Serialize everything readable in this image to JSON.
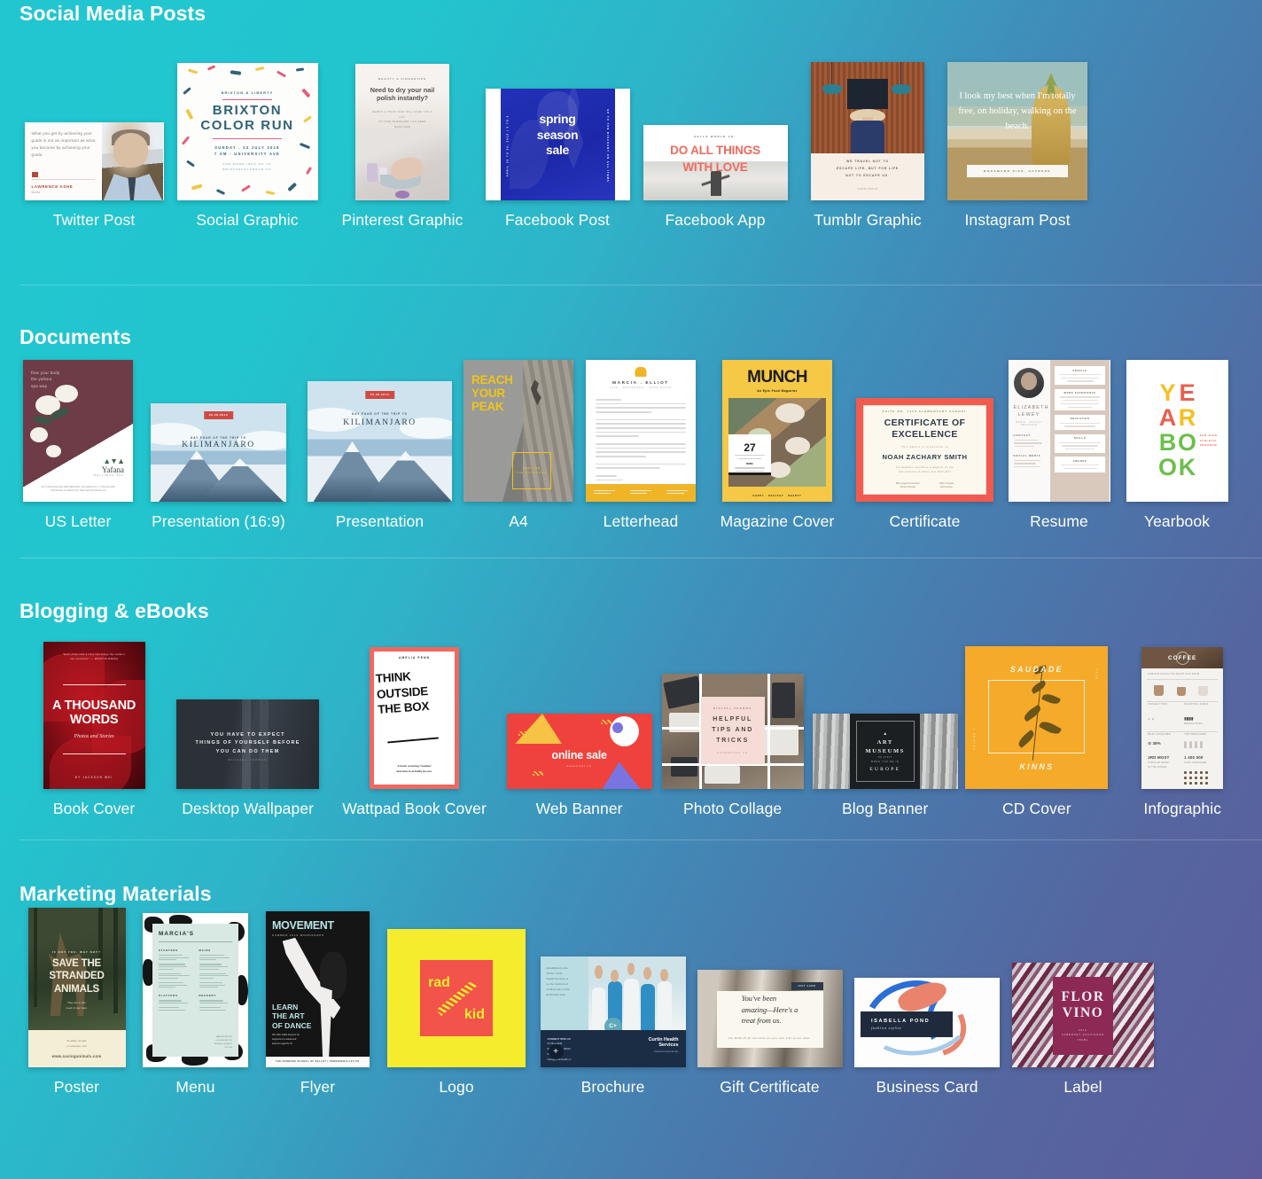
{
  "sections": [
    {
      "id": "social-media-posts",
      "heading": "Social Media Posts",
      "items": [
        {
          "id": "twitter-post",
          "label": "Twitter Post"
        },
        {
          "id": "social-graphic",
          "label": "Social Graphic"
        },
        {
          "id": "pinterest-graphic",
          "label": "Pinterest Graphic"
        },
        {
          "id": "facebook-post",
          "label": "Facebook Post"
        },
        {
          "id": "facebook-app",
          "label": "Facebook App"
        },
        {
          "id": "tumblr-graphic",
          "label": "Tumblr Graphic"
        },
        {
          "id": "instagram-post",
          "label": "Instagram Post"
        }
      ]
    },
    {
      "id": "documents",
      "heading": "Documents",
      "items": [
        {
          "id": "us-letter",
          "label": "US Letter"
        },
        {
          "id": "presentation-16-9",
          "label": "Presentation (16:9)"
        },
        {
          "id": "presentation",
          "label": "Presentation"
        },
        {
          "id": "a4",
          "label": "A4"
        },
        {
          "id": "letterhead",
          "label": "Letterhead"
        },
        {
          "id": "magazine-cover",
          "label": "Magazine Cover"
        },
        {
          "id": "certificate",
          "label": "Certificate"
        },
        {
          "id": "resume",
          "label": "Resume"
        },
        {
          "id": "yearbook",
          "label": "Yearbook"
        }
      ]
    },
    {
      "id": "blogging-ebooks",
      "heading": "Blogging & eBooks",
      "items": [
        {
          "id": "book-cover",
          "label": "Book Cover"
        },
        {
          "id": "desktop-wallpaper",
          "label": "Desktop Wallpaper"
        },
        {
          "id": "wattpad-book-cover",
          "label": "Wattpad Book Cover"
        },
        {
          "id": "web-banner",
          "label": "Web Banner"
        },
        {
          "id": "photo-collage",
          "label": "Photo Collage"
        },
        {
          "id": "blog-banner",
          "label": "Blog Banner"
        },
        {
          "id": "cd-cover",
          "label": "CD Cover"
        },
        {
          "id": "infographic",
          "label": "Infographic"
        }
      ]
    },
    {
      "id": "marketing-materials",
      "heading": "Marketing Materials",
      "items": [
        {
          "id": "poster",
          "label": "Poster"
        },
        {
          "id": "menu",
          "label": "Menu"
        },
        {
          "id": "flyer",
          "label": "Flyer"
        },
        {
          "id": "logo",
          "label": "Logo"
        },
        {
          "id": "brochure",
          "label": "Brochure"
        },
        {
          "id": "gift-certificate",
          "label": "Gift Certificate"
        },
        {
          "id": "business-card",
          "label": "Business Card"
        },
        {
          "id": "label",
          "label": "Label"
        }
      ]
    }
  ],
  "thumbnails": {
    "twitter_post": {
      "quote": "What you get by achieving your goals is not as important as what you become by achieving your goals.",
      "name": "LAWRENCE ASHE",
      "role": "Mentor"
    },
    "social_graphic": {
      "eyebrow": "BRIXTON & LIBERTY",
      "title_line1": "BRIXTON",
      "title_line2": "COLOR RUN",
      "date_line1": "SUNDAY  .  23 JULY 2018",
      "date_line2": "7 AM  -  UNIVERSITY AVE",
      "small_line1": "FOR MORE INFO GO TO",
      "small_line2": "BRIXTONCOLORRUN.CO"
    },
    "pinterest_graphic": {
      "eyebrow": "BEAUTY & FINGERTIPS",
      "title": "Need to dry your nail polish instantly?",
      "sub_line1": "HERE'S A TRICK THAT WILL SAVE YOU A LOT",
      "sub_line2": "OF TIME WHENEVER YOU NEED MANICURE"
    },
    "facebook_post": {
      "headline_line1": "spring",
      "headline_line2": "season",
      "headline_line3": "sale",
      "side_left": "APRIL 28 TO 30, 2018 | 9 TO 5",
      "side_right": "UP TO 70% DISCOUNT ON ALL ITEMS"
    },
    "facebook_app": {
      "eyebrow": "HELLO WORLD CO.",
      "headline_line1": "DO ALL THINGS",
      "headline_line2": "WITH LOVE"
    },
    "tumblr_graphic": {
      "quote_line1": "WE TRAVEL NOT TO",
      "quote_line2": "ESCAPE LIFE, BUT FOR LIFE",
      "quote_line3": "NOT TO ESCAPE US.",
      "attribution": "ANONYMOUS"
    },
    "instagram_post": {
      "quote": "I look my best when I'm totally free, on holiday, walking on the beach.",
      "plate": "ROSAMUND PIKE, ACTRESS"
    },
    "us_letter": {
      "headline_line1": "flow your body",
      "headline_line2": "the yafana",
      "headline_line3": "spa way",
      "brand": "Yafana",
      "brand_sub": "WELLNESS SPA",
      "footer_line1": "1671 HIGHLAND AVE NEW BEDFORD, MA 02840-1972  |  T: 555-294-4658",
      "footer_line2": "YAFANASPA.CO  REACHUS: HELLO@YAFANASPA.CO"
    },
    "presentation_169": {
      "badge": "05.28.2014",
      "eyebrow": "DAY FOUR OF THE TRIP TO",
      "title": "KILIMANJARO"
    },
    "presentation": {
      "badge": "05.28.2014",
      "eyebrow": "DAY FOUR OF THE TRIP TO",
      "title": "KILIMANJARO"
    },
    "a4": {
      "headline_line1": "REACH",
      "headline_line2": "YOUR",
      "headline_line3": "PEAK",
      "box_line1": "EXPLORE",
      "box_line2": "THE OUTDOORS"
    },
    "letterhead": {
      "name": "MARCIA . ELLIOT",
      "sub": "CAFE . RESTAURANT . BAKE HOUSE",
      "sign_off": "Sincerely,",
      "signature": "Marcia Elliot"
    },
    "magazine_cover": {
      "title": "MUNCH",
      "subtitle": "An Epic Food Magazine",
      "number": "27",
      "card_line1": "BEST VEGGIE DISHES FROM AROUND THE WORLD",
      "card_label": "MORE",
      "footer": "HAPPY . HEALTHY . HEARTY"
    },
    "certificate": {
      "eyebrow": "SUITE NO. 1400 ELEMENTARY SCHOOL",
      "title_line1": "CERTIFICATE OF",
      "title_line2": "EXCELLENCE",
      "presented": "This award is presented to",
      "name": "NOAH ZACHARY SMITH",
      "desc_line1": "For academic excellence in English, for the",
      "desc_line2": "first semester of school year 2016-2017",
      "sig_left_line1": "Mary Angelica Fernandez",
      "sig_left_line2": "School Principal",
      "sig_right_line1": "Wilbur Douglas",
      "sig_right_line2": "Class Adviser"
    },
    "resume": {
      "name_line1": "ELIZABETH",
      "name_line2": "LEWEY",
      "role": "MEDIA . DIGITAL DESIGNER",
      "section1": "CONTACT",
      "section2": "SOCIAL MEDIA",
      "rsection1": "PROFILE",
      "rsection2": "WORK EXPERIENCE",
      "rsection3": "EDUCATION",
      "rsection4": "SKILLS",
      "rsection5": "AWARDS"
    },
    "yearbook": {
      "letters": [
        "Y",
        "E",
        "A",
        "R",
        "B",
        "O",
        "O",
        "K"
      ],
      "colors": [
        "#f3c01f",
        "#e8604f",
        "#e8604f",
        "#f3c01f",
        "#6bbf4b",
        "#6bbf4b",
        "#6bbf4b",
        "#6bbf4b"
      ],
      "badge_line1": "SAN JUAN",
      "badge_line2": "ATHLETIC",
      "badge_line3": "PROGRAM"
    },
    "book_cover": {
      "praise_line1": "\"Each photo tells a story that brings the reader's",
      "praise_line2": "own memories.\" — WINSTON MARSH",
      "title_line1": "A THOUSAND",
      "title_line2": "WORDS",
      "subtitle": "Photos and Stories",
      "author": "BY JACKSON WEI"
    },
    "desktop_wallpaper": {
      "quote_line1": "YOU HAVE TO EXPECT",
      "quote_line2": "THINGS OF YOURSELF BEFORE",
      "quote_line3": "YOU CAN DO THEM",
      "attribution": "MICHAEL JORDAN"
    },
    "wattpad_book_cover": {
      "author": "AMELIA PENN",
      "title_line1": "THINK",
      "title_line2": "OUTSIDE",
      "title_line3": "THE BOX",
      "sub_line1": "A book on being 'creative'",
      "sub_line2": "and how to actually be one."
    },
    "web_banner": {
      "headline": "online sale",
      "sub": "Essential.co"
    },
    "photo_collage": {
      "eyebrow": "DIGITAL TRENDS",
      "title_line1": "HELPFUL",
      "title_line2": "TIPS AND",
      "title_line3": "TRICKS",
      "sub": "HOMEBASED.CO"
    },
    "blog_banner": {
      "title_line1": "ART",
      "title_line2": "MUSEUMS",
      "sub_line1": "TO VISIT",
      "sub_line2": "WHEN YOU'RE IN",
      "region": "EUROPE"
    },
    "cd_cover": {
      "top": "SAUDADE",
      "bottom": "KINNS",
      "side_left": "VOLUME I",
      "side_right": "2018"
    },
    "infographic": {
      "title": "COFFEE",
      "sub": "CURIOUS FACTS YOU MIGHT NOT KNOW",
      "stat1": "3RD MOST",
      "stat2": "1 400 000",
      "label1": "POPULAR DRINK",
      "label2": "IN THE WORLD",
      "label3": "CUPS CONSUMED"
    },
    "poster": {
      "eyebrow": "IF NOT YOU, WHY NOT?",
      "title_line1": "SAVE THE",
      "title_line2": "STRANDED",
      "title_line3": "ANIMALS",
      "sub_line1": "They are in dire",
      "sub_line2": "need of your help.",
      "foot_line1": "To adopt, donate",
      "foot_line2": "or volunteer, visit",
      "foot_url": "www.savinganimals.com"
    },
    "menu": {
      "title": "MARCIA'S",
      "col1_h1": "STARTERS",
      "col1_h2": "PLATTERS",
      "col2_h1": "MAINS",
      "col2_h2": "DESSERT",
      "footer_line1": "MARCIA'S BISTRO",
      "footer_line2": "1400 WHITEWOOD",
      "footer_line3": "AVENUE, MILLBURY",
      "footer_line4": "555 0198"
    },
    "flyer": {
      "title": "MOVEMENT",
      "sub": "SUMMER 2019 WORKSHOPS",
      "headline_line1": "LEARN",
      "headline_line2": "THE ART",
      "headline_line3": "OF DANCE",
      "body_line1": "We offer ballet lessons for",
      "body_line2": "beginners to advanced",
      "body_line3": "learners aged 5-19.",
      "footer": "THE PENROSE SCHOOL OF BALLET  |  PENROSEBALLET.CO"
    },
    "logo": {
      "word1": "rad",
      "word2": "kid"
    },
    "brochure": {
      "intro_line1": "Established in the",
      "intro_line2": "1970s, Curtin",
      "intro_line3": "Health Services is",
      "intro_line4": "on the forefront of",
      "intro_line5": "medical care in the",
      "intro_line6": "El Dorado area.",
      "badge": "C+",
      "contact_label": "CONNECT WITH US",
      "contact_line1": "PO Box 4648",
      "contact_line2": "El Dorado, CA 95623",
      "contact_line3": "555 0132",
      "contact_line4": "hello@curtinhealth.co",
      "brand_line1": "Curtin Health",
      "brand_line2": "Services",
      "brand_sub": "Trusted and personal care"
    },
    "gift_certificate": {
      "tab": "GIFT CARD",
      "quote_line1": "You've been",
      "quote_line2": "amazing—Here's a",
      "quote_line3": "treat from us.",
      "fine_print": "Get $100 off all our items on your next visit to our shop."
    },
    "business_card": {
      "name": "ISABELLA POND",
      "role": "fashion stylist"
    },
    "label": {
      "title_line1": "FLOR",
      "title_line2": "VINO",
      "sub_line1": "2014",
      "sub_line2": "CABERNET SAUVIGNON",
      "sub_line3": "750ML"
    }
  }
}
